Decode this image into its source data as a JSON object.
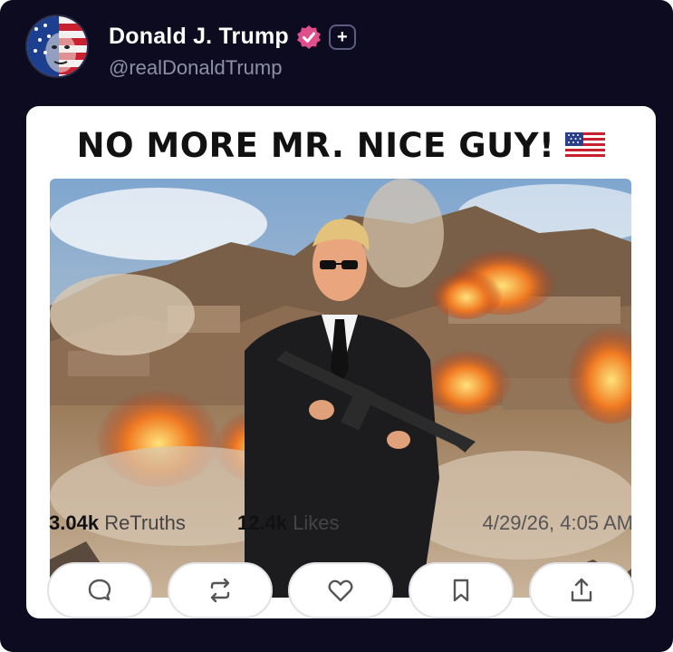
{
  "account": {
    "display_name": "Donald J. Trump",
    "handle": "@realDonaldTrump",
    "plus_badge": "+",
    "verified_color": "#e04e8c"
  },
  "post": {
    "headline": "NO MORE MR. NICE GUY!",
    "flag_icon": "us-flag-icon",
    "image_description_icon": "post-image"
  },
  "stats": {
    "retruths_count": "3.04k",
    "retruths_label": "ReTruths",
    "likes_count": "12.4k",
    "likes_label": "Likes",
    "timestamp": "4/29/26, 4:05 AM"
  },
  "actions": [
    {
      "name": "reply",
      "icon": "comment-icon"
    },
    {
      "name": "retruth",
      "icon": "repost-icon"
    },
    {
      "name": "like",
      "icon": "heart-icon"
    },
    {
      "name": "bookmark",
      "icon": "bookmark-icon"
    },
    {
      "name": "share",
      "icon": "share-icon"
    }
  ],
  "theme": {
    "background": "#0c0b1f",
    "card": "#ffffff",
    "accent": "#e04e8c"
  }
}
